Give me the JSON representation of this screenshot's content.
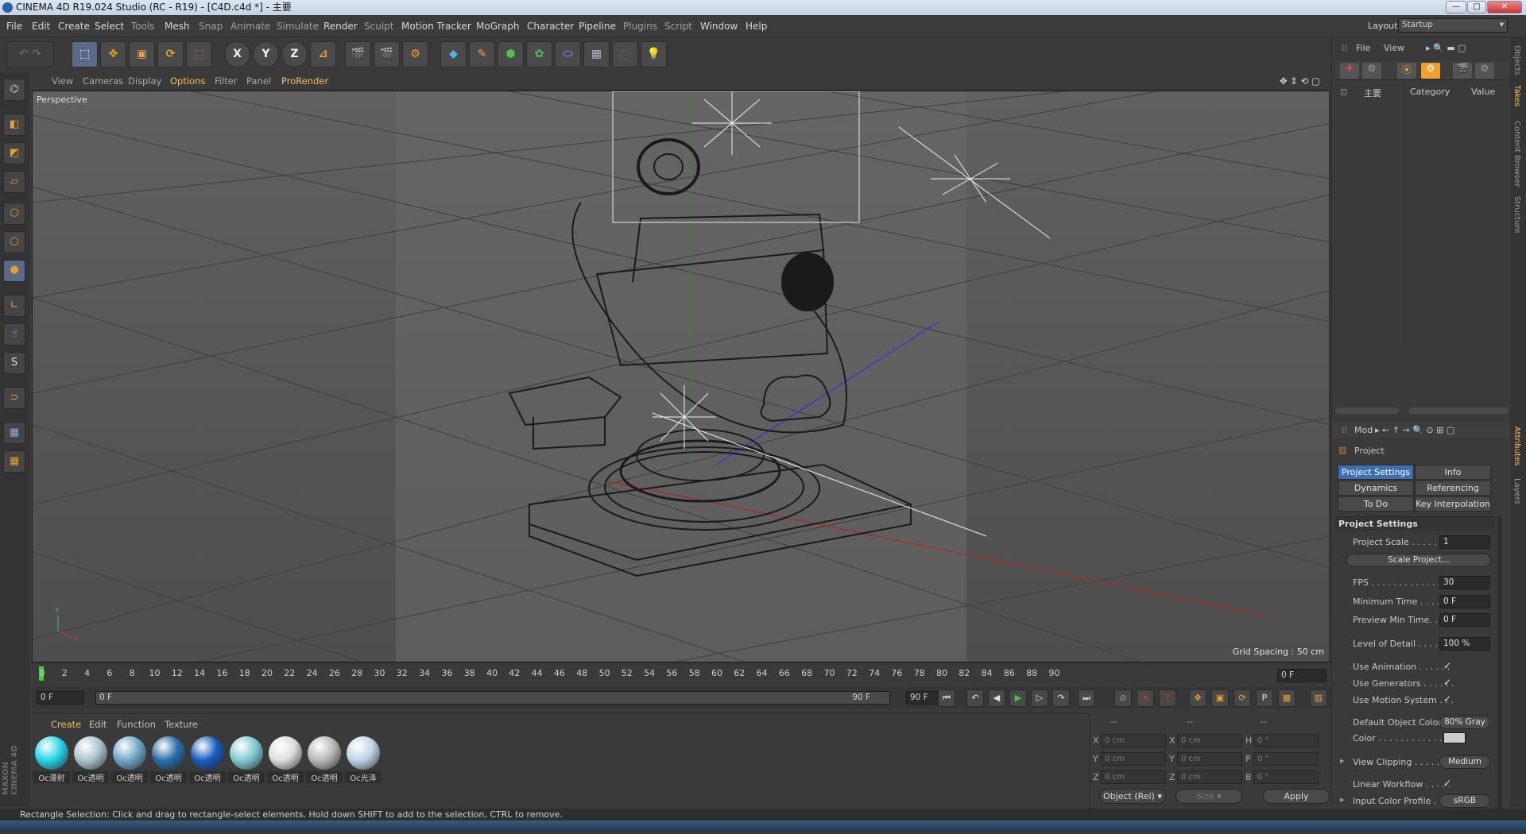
{
  "window": {
    "title": "CINEMA 4D R19.024 Studio (RC - R19) - [C4D.c4d *] - 主要",
    "min": "—",
    "max": "□",
    "close": "✕"
  },
  "menu": [
    "File",
    "Edit",
    "Create",
    "Select",
    "Tools",
    "Mesh",
    "Snap",
    "Animate",
    "Simulate",
    "Render",
    "Sculpt",
    "Motion Tracker",
    "MoGraph",
    "Character",
    "Pipeline",
    "Plugins",
    "Script",
    "Window",
    "Help"
  ],
  "layout": {
    "label": "Layout:",
    "value": "Startup"
  },
  "toolbar": {
    "x": "X",
    "y": "Y",
    "z": "Z"
  },
  "viewport": {
    "menu": [
      "View",
      "Cameras",
      "Display",
      "Options",
      "Filter",
      "Panel",
      "ProRender"
    ],
    "label": "Perspective",
    "grid_spacing": "Grid Spacing : 50 cm"
  },
  "timeline": {
    "ticks": [
      "0",
      "2",
      "4",
      "6",
      "8",
      "10",
      "12",
      "14",
      "16",
      "18",
      "20",
      "22",
      "24",
      "26",
      "28",
      "30",
      "32",
      "34",
      "36",
      "38",
      "40",
      "42",
      "44",
      "46",
      "48",
      "50",
      "52",
      "54",
      "56",
      "58",
      "60",
      "62",
      "64",
      "66",
      "68",
      "70",
      "72",
      "74",
      "76",
      "78",
      "80",
      "82",
      "84",
      "86",
      "88",
      "90"
    ],
    "current": "0 F",
    "start": "0 F",
    "range_start": "0 F",
    "range_end": "90 F",
    "end": "90 F"
  },
  "materials": {
    "menu": [
      "Create",
      "Edit",
      "Function",
      "Texture"
    ],
    "items": [
      {
        "label": "Oc漫射",
        "color": "#27d4e8"
      },
      {
        "label": "Oc透明",
        "color": "#a8c4cc"
      },
      {
        "label": "Oc透明",
        "color": "#6fa8c8"
      },
      {
        "label": "Oc透明",
        "color": "#2a6ea8"
      },
      {
        "label": "Oc透明",
        "color": "#1a5cc0"
      },
      {
        "label": "Oc透明",
        "color": "#7ecad0"
      },
      {
        "label": "Oc透明",
        "color": "#dcdcdc"
      },
      {
        "label": "Oc透明",
        "color": "#b8b8b8"
      },
      {
        "label": "Oc光泽",
        "color": "#c0d4e8"
      }
    ],
    "brand": "MAXON CINEMA 4D"
  },
  "coords": {
    "header": [
      "--",
      "--",
      "--"
    ],
    "rows": [
      {
        "a": "X",
        "av": "0 cm",
        "b": "X",
        "bv": "0 cm",
        "c": "H",
        "cv": "0 °"
      },
      {
        "a": "Y",
        "av": "0 cm",
        "b": "Y",
        "bv": "0 cm",
        "c": "P",
        "cv": "0 °"
      },
      {
        "a": "Z",
        "av": "0 cm",
        "b": "Z",
        "bv": "0 cm",
        "c": "B",
        "cv": "0 °"
      }
    ],
    "mode": "Object (Rel)",
    "size": "Size",
    "apply": "Apply"
  },
  "objects": {
    "menu": [
      "File",
      "View"
    ],
    "takes_root": "主要",
    "col_category": "Category",
    "col_value": "Value"
  },
  "side_tabs_top": [
    "Objects",
    "Takes",
    "Content Browser",
    "Structure"
  ],
  "side_tabs_bottom": [
    "Attributes",
    "Layers"
  ],
  "attributes": {
    "mode": "Mod",
    "title": "Project",
    "tabs": [
      "Project Settings",
      "Info",
      "Dynamics",
      "Referencing",
      "To Do",
      "Key Interpolation"
    ],
    "section": "Project Settings",
    "props": {
      "scale_label": "Project Scale . . . . . . .",
      "scale": "1",
      "scale_btn": "Scale Project...",
      "fps_label": "FPS . . . . . . . . . . . . . .",
      "fps": "30",
      "min_label": "Minimum Time . . . . . .",
      "min": "0 F",
      "pmin_label": "Preview Min Time. . . .",
      "pmin": "0 F",
      "lod_label": "Level of Detail . . . . . .",
      "lod": "100 %",
      "anim_label": "Use Animation . . . . . .",
      "gen_label": "Use Generators . . . . . .",
      "motion_label": "Use Motion System . . .",
      "doc_label": "Default Object Color",
      "doc": "80% Gray",
      "color_label": "Color . . . . . . . . . . . .",
      "clip_label": "View Clipping . . . . . . .",
      "clip": "Medium",
      "lin_label": "Linear Workflow . . . . .",
      "icp_label": "Input Color Profile . . .",
      "icp": "sRGB",
      "check": "✓"
    }
  },
  "status": "Rectangle Selection: Click and drag to rectangle-select elements. Hold down SHIFT to add to the selection, CTRL to remove."
}
